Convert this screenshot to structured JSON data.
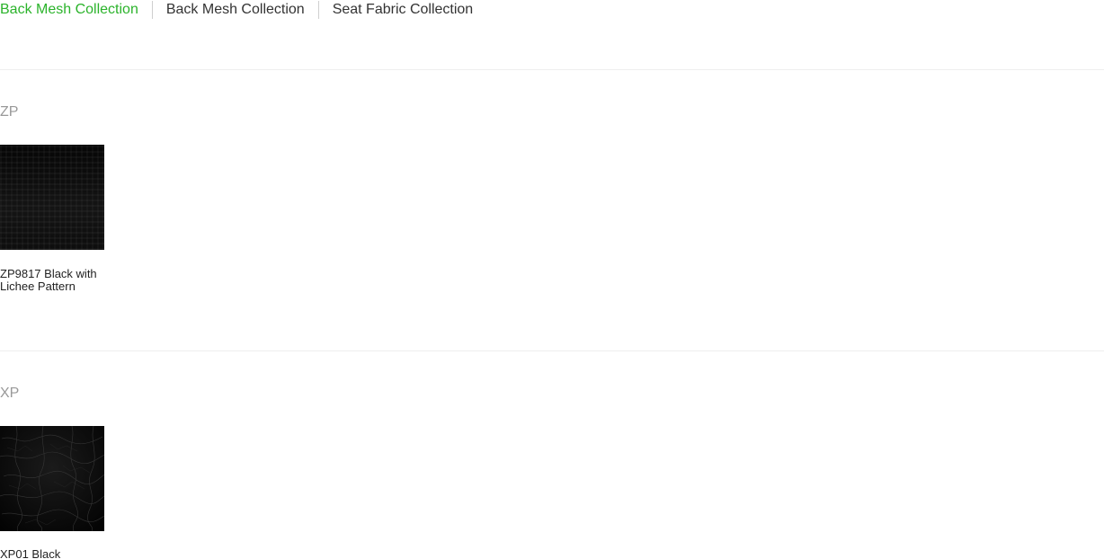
{
  "tabs": [
    {
      "label": "Back Mesh Collection",
      "active": true
    },
    {
      "label": "Back Mesh Collection",
      "active": false
    },
    {
      "label": "Seat Fabric Collection",
      "active": false
    }
  ],
  "groups": [
    {
      "title": "ZP",
      "items": [
        {
          "name": "ZP9817 Black with Lichee Pattern",
          "swatch_color": "#0b0b0b"
        }
      ]
    },
    {
      "title": "XP",
      "items": [
        {
          "name": "XP01 Black",
          "swatch_color": "#050505"
        }
      ]
    }
  ],
  "colors": {
    "active_tab": "#2bb32b",
    "tab_text": "#333333",
    "group_title": "#999999",
    "divider": "#eeeeee"
  }
}
